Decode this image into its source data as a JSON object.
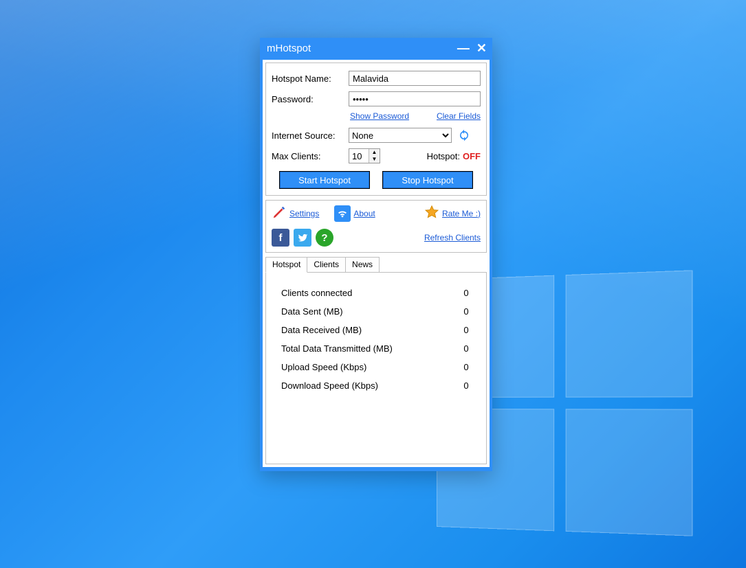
{
  "window": {
    "title": "mHotspot"
  },
  "form": {
    "hotspot_name_label": "Hotspot Name:",
    "hotspot_name_value": "Malavida",
    "password_label": "Password:",
    "password_value": "•••••",
    "show_password": "Show Password",
    "clear_fields": "Clear Fields",
    "internet_source_label": "Internet Source:",
    "internet_source_value": "None",
    "max_clients_label": "Max Clients:",
    "max_clients_value": "10",
    "hotspot_status_label": "Hotspot:",
    "hotspot_status_value": "OFF",
    "start_button": "Start Hotspot",
    "stop_button": "Stop Hotspot"
  },
  "utils": {
    "settings": "Settings",
    "about": "About",
    "rate_me": "Rate Me :)",
    "refresh_clients": "Refresh Clients "
  },
  "tabs": {
    "hotspot": "Hotspot",
    "clients": "Clients",
    "news": "News"
  },
  "stats": [
    {
      "label": "Clients connected",
      "value": "0"
    },
    {
      "label": "Data Sent (MB)",
      "value": "0"
    },
    {
      "label": "Data Received (MB)",
      "value": "0"
    },
    {
      "label": "Total Data Transmitted (MB)",
      "value": "0"
    },
    {
      "label": "Upload Speed (Kbps)",
      "value": "0"
    },
    {
      "label": "Download Speed (Kbps)",
      "value": "0"
    }
  ]
}
